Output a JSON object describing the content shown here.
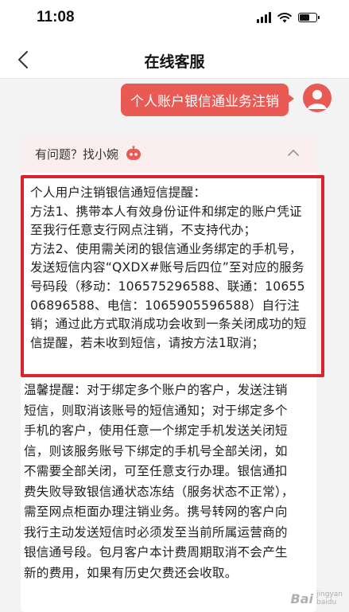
{
  "status_bar": {
    "time": "11:08"
  },
  "nav": {
    "title": "在线客服"
  },
  "chat": {
    "user_message": "个人账户银信通业务注销",
    "reply_header": "有问题？找小婉",
    "reply_paragraphs": [
      "个人用户注销银信通短信提醒：",
      "方法1、携带本人有效身份证件和绑定的账户凭证至我行任意支行网点注销，不支持代办；",
      "方法2、使用需关闭的银信通业务绑定的手机号，发送短信内容“QXDX#账号后四位”至对应的服务号码段（移动：10657529658​8、联通：1065506896588、电信：1065905596588）自行注销；通过此方式取消成功会收到一条关闭成功的短信提醒，若未收到短信，请按方法1取消；"
    ],
    "tips": "温馨提醒：对于绑定多个账户的客户，发送注销短信，则取消该账号的短信通知；对于绑定多个手机的客户，使用任意一个绑定手机发送关闭短信，则该服务账号下绑定的手机号全部关闭，如不需要全部关闭，可至任意支行办理。银信通扣费失败导致银信通状态冻结（服务状态不正常），需至网点柜面办理注销业务。携号转网的客户向我行主动发送短信时必须发至当前所属运营商的银信通号段。包月客户本计费周期取消不会产生新的费用，如果有历史欠费还会收取。"
  },
  "watermark": {
    "brand": "Bai",
    "sub_line1": "jingyan",
    "sub_line2": "baidu"
  },
  "colors": {
    "accent": "#ea5a54",
    "highlight": "#d9232d",
    "header_bg": "#fbeeee"
  }
}
